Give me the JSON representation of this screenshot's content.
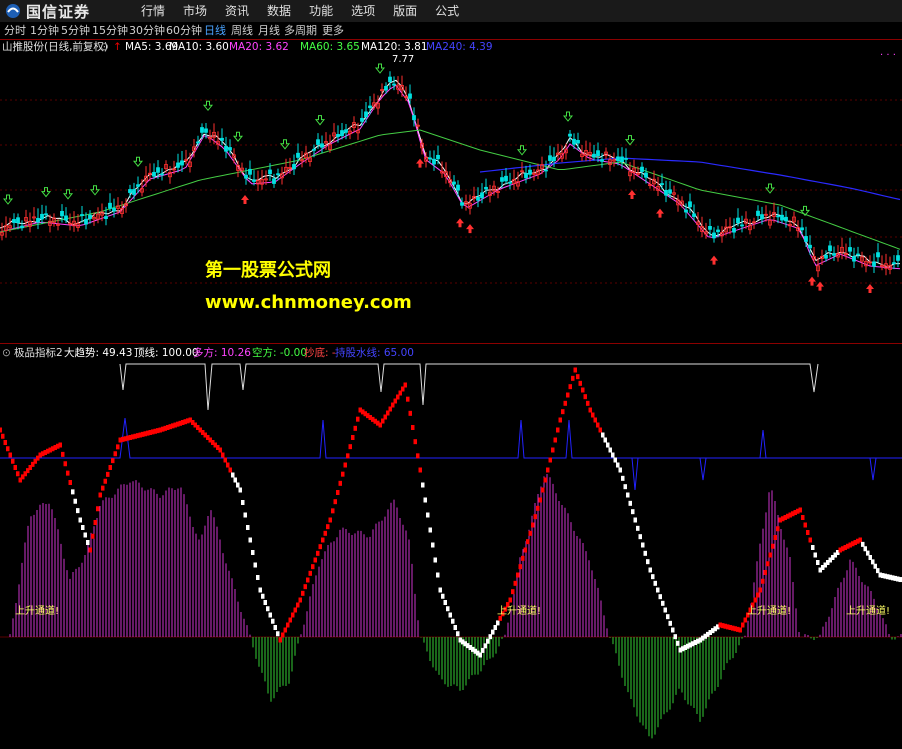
{
  "app": {
    "logo_text": "国信证券",
    "menu": [
      "行情",
      "市场",
      "资讯",
      "数据",
      "功能",
      "选项",
      "版面",
      "公式"
    ]
  },
  "periods": {
    "items": [
      "分时",
      "1分钟",
      "5分钟",
      "15分钟",
      "30分钟",
      "60分钟",
      "日线",
      "周线",
      "月线",
      "多周期",
      "更多"
    ],
    "active": "日线"
  },
  "main_chart": {
    "stock": "山推股份(日线,前复权)",
    "ma": [
      {
        "label": "MA5: 3.69",
        "color": "#ffffff"
      },
      {
        "label": "MA10: 3.60",
        "color": "#ffffff"
      },
      {
        "label": "MA20: 3.62",
        "color": "#ff44ff"
      },
      {
        "label": "MA60: 3.65",
        "color": "#44ff44"
      },
      {
        "label": "MA120: 3.81",
        "color": "#ffffff"
      },
      {
        "label": "MA240: 4.39",
        "color": "#4444ff"
      }
    ],
    "high_label": "7.77"
  },
  "watermark": {
    "line1": "第一股票公式网",
    "line2": "www.chnmoney.com"
  },
  "sub_chart": {
    "name": "极品指标2",
    "fields": [
      {
        "label": "大趋势: 49.43",
        "color": "#ffffff"
      },
      {
        "label": "顶线: 100.00",
        "color": "#ffffff"
      },
      {
        "label": "多方: 10.26",
        "color": "#ff44ff"
      },
      {
        "label": "空方: -0.00",
        "color": "#44ff44"
      },
      {
        "label": "抄底: -",
        "color": "#ff4444"
      },
      {
        "label": "持股水线: 65.00",
        "color": "#4444ff"
      }
    ],
    "channel_label": "上升通道!"
  },
  "colors": {
    "up": "#ff3030",
    "down": "#30ff30",
    "ma_white": "#ffffff",
    "ma_magenta": "#ff44ff",
    "ma_green": "#44cc44",
    "ma_blue": "#2a2aff",
    "trend_red": "#ff0000",
    "trend_white": "#ffffff",
    "bull_bars": "#cc33cc",
    "bear_bars": "#33cc33",
    "hold_line": "#2222ff"
  }
}
